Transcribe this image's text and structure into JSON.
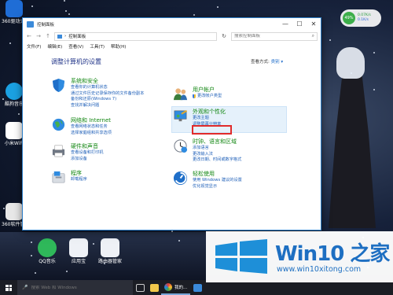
{
  "window": {
    "title": "控制面板",
    "address": "控制面板",
    "search_placeholder": "搜索控制面板",
    "menu": [
      "文件(F)",
      "编辑(E)",
      "查看(V)",
      "工具(T)",
      "帮助(H)"
    ],
    "heading": "调整计算机的设置",
    "view_by_label": "查看方式:",
    "view_by_value": "类别 ▾"
  },
  "categories": [
    {
      "title": "系统和安全",
      "links": [
        "查看你的计算机状态",
        "通过文件历史记录保存你的文件备份副本",
        "备份和还原(Windows 7)",
        "查找并解决问题"
      ]
    },
    {
      "title": "网络和 Internet",
      "links": [
        "查看网络状态和任务",
        "选择家庭组和共享选项"
      ]
    },
    {
      "title": "硬件和声音",
      "links": [
        "查看设备和打印机",
        "添加设备"
      ]
    },
    {
      "title": "程序",
      "links": [
        "卸载程序"
      ]
    },
    {
      "title": "用户帐户",
      "links": [
        "更改帐户类型"
      ]
    },
    {
      "title": "外观和个性化",
      "links": [
        "更改主题",
        "调整屏幕分辨率"
      ]
    },
    {
      "title": "时钟、语言和区域",
      "links": [
        "添加语言",
        "更改输入法",
        "更改日期、时间或数字格式"
      ]
    },
    {
      "title": "轻松使用",
      "links": [
        "使用 Windows 建议的设置",
        "优化视觉显示"
      ]
    }
  ],
  "desktop_icons": [
    "360驱动大师",
    "酷狗音乐",
    "小米WiFi",
    "360软件管家"
  ],
  "bottom_icons": [
    "QQ音乐",
    "应用宝",
    "路由器管家"
  ],
  "network_widget": {
    "percent": "49%",
    "up": "0.07K/s",
    "down": "0.1K/s"
  },
  "taskbar": {
    "search_placeholder": "搜索 Web 和 Windows",
    "running_app": "我的..."
  },
  "watermark": {
    "title": "Win10 之家",
    "url": "www.win10xitong.com"
  },
  "colors": {
    "accent": "#1e5fb8",
    "category_green": "#138713",
    "highlight_red": "#e12b2b",
    "brand_blue": "#1e6fc2"
  }
}
